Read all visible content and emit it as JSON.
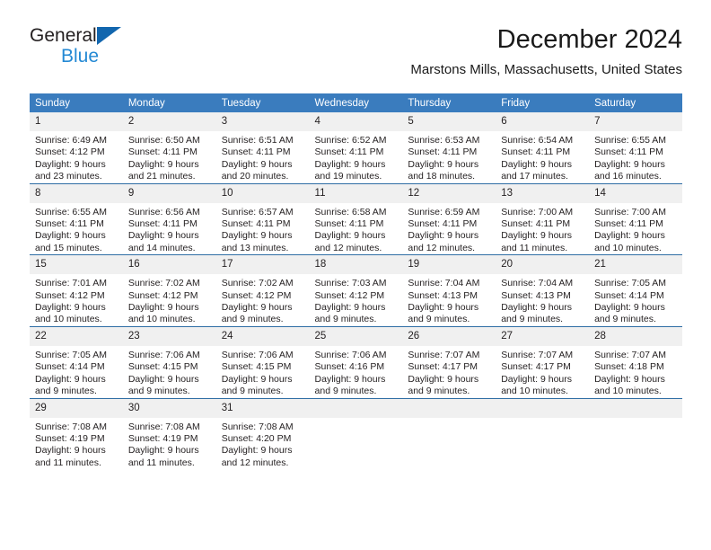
{
  "brand": {
    "name_dark": "General",
    "name_blue": "Blue",
    "triangle_icon": "triangle-icon",
    "accent_blue": "#2489d4",
    "triangle_blue": "#1266ae"
  },
  "header": {
    "title": "December 2024",
    "subtitle": "Marstons Mills, Massachusetts, United States"
  },
  "calendar": {
    "header_bg": "#3a7cbe",
    "daynum_bg": "#f0f0f0",
    "row_border": "#2e6da4",
    "weekdays": [
      "Sunday",
      "Monday",
      "Tuesday",
      "Wednesday",
      "Thursday",
      "Friday",
      "Saturday"
    ],
    "weeks": [
      [
        {
          "day": "1",
          "sunrise": "Sunrise: 6:49 AM",
          "sunset": "Sunset: 4:12 PM",
          "daylight_line1": "Daylight: 9 hours",
          "daylight_line2": "and 23 minutes."
        },
        {
          "day": "2",
          "sunrise": "Sunrise: 6:50 AM",
          "sunset": "Sunset: 4:11 PM",
          "daylight_line1": "Daylight: 9 hours",
          "daylight_line2": "and 21 minutes."
        },
        {
          "day": "3",
          "sunrise": "Sunrise: 6:51 AM",
          "sunset": "Sunset: 4:11 PM",
          "daylight_line1": "Daylight: 9 hours",
          "daylight_line2": "and 20 minutes."
        },
        {
          "day": "4",
          "sunrise": "Sunrise: 6:52 AM",
          "sunset": "Sunset: 4:11 PM",
          "daylight_line1": "Daylight: 9 hours",
          "daylight_line2": "and 19 minutes."
        },
        {
          "day": "5",
          "sunrise": "Sunrise: 6:53 AM",
          "sunset": "Sunset: 4:11 PM",
          "daylight_line1": "Daylight: 9 hours",
          "daylight_line2": "and 18 minutes."
        },
        {
          "day": "6",
          "sunrise": "Sunrise: 6:54 AM",
          "sunset": "Sunset: 4:11 PM",
          "daylight_line1": "Daylight: 9 hours",
          "daylight_line2": "and 17 minutes."
        },
        {
          "day": "7",
          "sunrise": "Sunrise: 6:55 AM",
          "sunset": "Sunset: 4:11 PM",
          "daylight_line1": "Daylight: 9 hours",
          "daylight_line2": "and 16 minutes."
        }
      ],
      [
        {
          "day": "8",
          "sunrise": "Sunrise: 6:55 AM",
          "sunset": "Sunset: 4:11 PM",
          "daylight_line1": "Daylight: 9 hours",
          "daylight_line2": "and 15 minutes."
        },
        {
          "day": "9",
          "sunrise": "Sunrise: 6:56 AM",
          "sunset": "Sunset: 4:11 PM",
          "daylight_line1": "Daylight: 9 hours",
          "daylight_line2": "and 14 minutes."
        },
        {
          "day": "10",
          "sunrise": "Sunrise: 6:57 AM",
          "sunset": "Sunset: 4:11 PM",
          "daylight_line1": "Daylight: 9 hours",
          "daylight_line2": "and 13 minutes."
        },
        {
          "day": "11",
          "sunrise": "Sunrise: 6:58 AM",
          "sunset": "Sunset: 4:11 PM",
          "daylight_line1": "Daylight: 9 hours",
          "daylight_line2": "and 12 minutes."
        },
        {
          "day": "12",
          "sunrise": "Sunrise: 6:59 AM",
          "sunset": "Sunset: 4:11 PM",
          "daylight_line1": "Daylight: 9 hours",
          "daylight_line2": "and 12 minutes."
        },
        {
          "day": "13",
          "sunrise": "Sunrise: 7:00 AM",
          "sunset": "Sunset: 4:11 PM",
          "daylight_line1": "Daylight: 9 hours",
          "daylight_line2": "and 11 minutes."
        },
        {
          "day": "14",
          "sunrise": "Sunrise: 7:00 AM",
          "sunset": "Sunset: 4:11 PM",
          "daylight_line1": "Daylight: 9 hours",
          "daylight_line2": "and 10 minutes."
        }
      ],
      [
        {
          "day": "15",
          "sunrise": "Sunrise: 7:01 AM",
          "sunset": "Sunset: 4:12 PM",
          "daylight_line1": "Daylight: 9 hours",
          "daylight_line2": "and 10 minutes."
        },
        {
          "day": "16",
          "sunrise": "Sunrise: 7:02 AM",
          "sunset": "Sunset: 4:12 PM",
          "daylight_line1": "Daylight: 9 hours",
          "daylight_line2": "and 10 minutes."
        },
        {
          "day": "17",
          "sunrise": "Sunrise: 7:02 AM",
          "sunset": "Sunset: 4:12 PM",
          "daylight_line1": "Daylight: 9 hours",
          "daylight_line2": "and 9 minutes."
        },
        {
          "day": "18",
          "sunrise": "Sunrise: 7:03 AM",
          "sunset": "Sunset: 4:12 PM",
          "daylight_line1": "Daylight: 9 hours",
          "daylight_line2": "and 9 minutes."
        },
        {
          "day": "19",
          "sunrise": "Sunrise: 7:04 AM",
          "sunset": "Sunset: 4:13 PM",
          "daylight_line1": "Daylight: 9 hours",
          "daylight_line2": "and 9 minutes."
        },
        {
          "day": "20",
          "sunrise": "Sunrise: 7:04 AM",
          "sunset": "Sunset: 4:13 PM",
          "daylight_line1": "Daylight: 9 hours",
          "daylight_line2": "and 9 minutes."
        },
        {
          "day": "21",
          "sunrise": "Sunrise: 7:05 AM",
          "sunset": "Sunset: 4:14 PM",
          "daylight_line1": "Daylight: 9 hours",
          "daylight_line2": "and 9 minutes."
        }
      ],
      [
        {
          "day": "22",
          "sunrise": "Sunrise: 7:05 AM",
          "sunset": "Sunset: 4:14 PM",
          "daylight_line1": "Daylight: 9 hours",
          "daylight_line2": "and 9 minutes."
        },
        {
          "day": "23",
          "sunrise": "Sunrise: 7:06 AM",
          "sunset": "Sunset: 4:15 PM",
          "daylight_line1": "Daylight: 9 hours",
          "daylight_line2": "and 9 minutes."
        },
        {
          "day": "24",
          "sunrise": "Sunrise: 7:06 AM",
          "sunset": "Sunset: 4:15 PM",
          "daylight_line1": "Daylight: 9 hours",
          "daylight_line2": "and 9 minutes."
        },
        {
          "day": "25",
          "sunrise": "Sunrise: 7:06 AM",
          "sunset": "Sunset: 4:16 PM",
          "daylight_line1": "Daylight: 9 hours",
          "daylight_line2": "and 9 minutes."
        },
        {
          "day": "26",
          "sunrise": "Sunrise: 7:07 AM",
          "sunset": "Sunset: 4:17 PM",
          "daylight_line1": "Daylight: 9 hours",
          "daylight_line2": "and 9 minutes."
        },
        {
          "day": "27",
          "sunrise": "Sunrise: 7:07 AM",
          "sunset": "Sunset: 4:17 PM",
          "daylight_line1": "Daylight: 9 hours",
          "daylight_line2": "and 10 minutes."
        },
        {
          "day": "28",
          "sunrise": "Sunrise: 7:07 AM",
          "sunset": "Sunset: 4:18 PM",
          "daylight_line1": "Daylight: 9 hours",
          "daylight_line2": "and 10 minutes."
        }
      ],
      [
        {
          "day": "29",
          "sunrise": "Sunrise: 7:08 AM",
          "sunset": "Sunset: 4:19 PM",
          "daylight_line1": "Daylight: 9 hours",
          "daylight_line2": "and 11 minutes."
        },
        {
          "day": "30",
          "sunrise": "Sunrise: 7:08 AM",
          "sunset": "Sunset: 4:19 PM",
          "daylight_line1": "Daylight: 9 hours",
          "daylight_line2": "and 11 minutes."
        },
        {
          "day": "31",
          "sunrise": "Sunrise: 7:08 AM",
          "sunset": "Sunset: 4:20 PM",
          "daylight_line1": "Daylight: 9 hours",
          "daylight_line2": "and 12 minutes."
        },
        {
          "day": "",
          "sunrise": "",
          "sunset": "",
          "daylight_line1": "",
          "daylight_line2": ""
        },
        {
          "day": "",
          "sunrise": "",
          "sunset": "",
          "daylight_line1": "",
          "daylight_line2": ""
        },
        {
          "day": "",
          "sunrise": "",
          "sunset": "",
          "daylight_line1": "",
          "daylight_line2": ""
        },
        {
          "day": "",
          "sunrise": "",
          "sunset": "",
          "daylight_line1": "",
          "daylight_line2": ""
        }
      ]
    ]
  }
}
